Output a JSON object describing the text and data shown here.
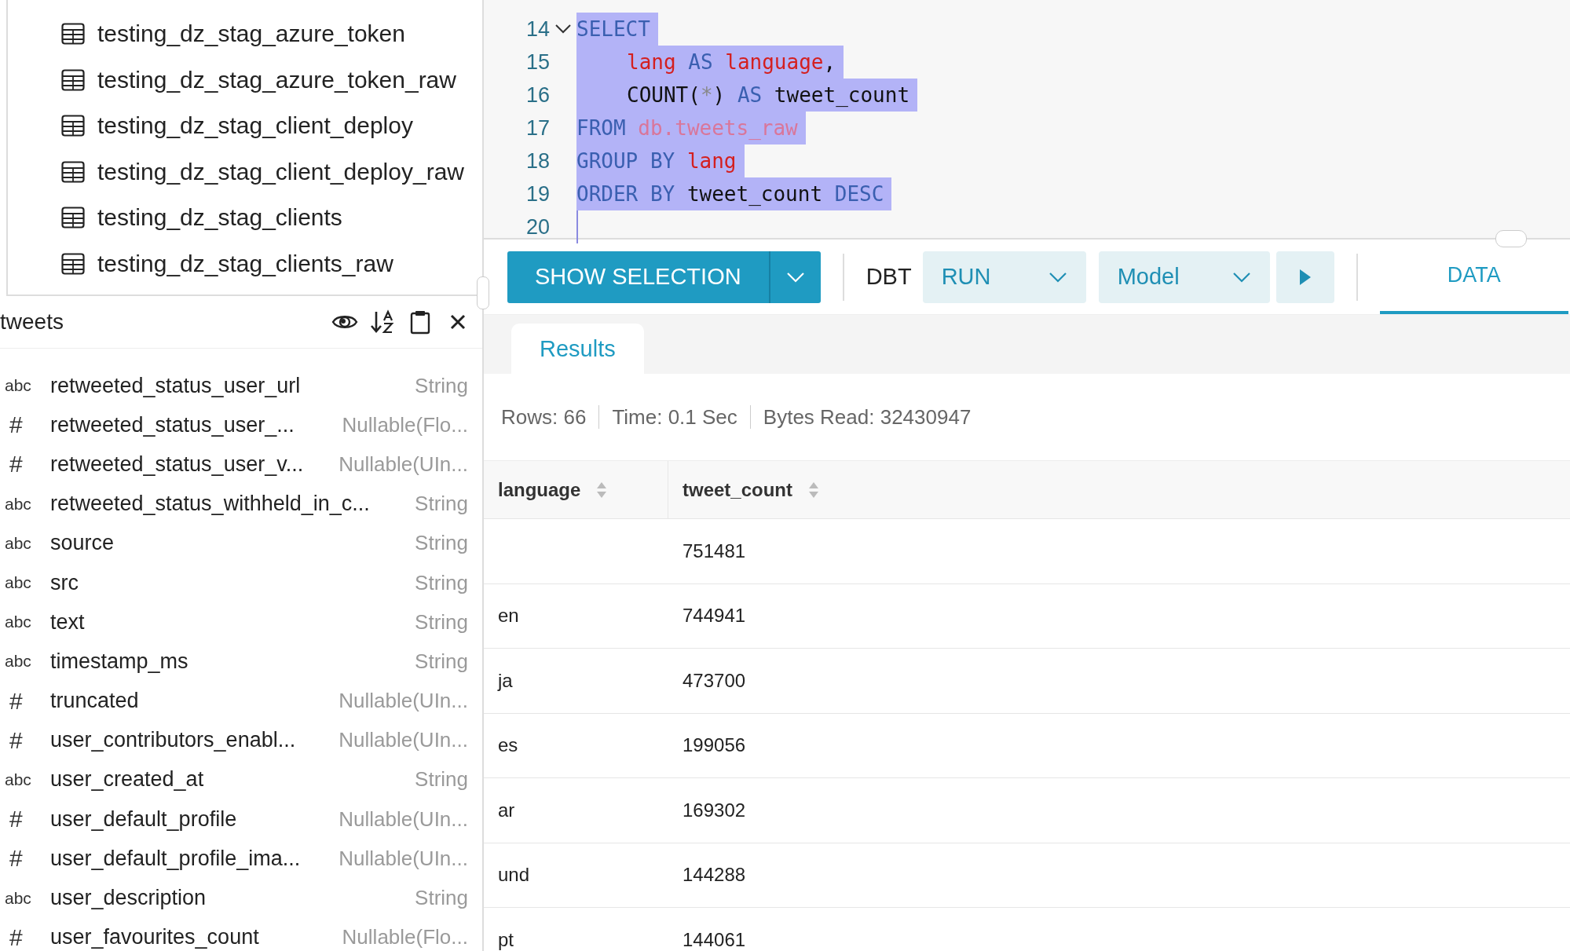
{
  "tree": {
    "items": [
      {
        "label": "testing_dz_stag_azure_token"
      },
      {
        "label": "testing_dz_stag_azure_token_raw"
      },
      {
        "label": "testing_dz_stag_client_deploy"
      },
      {
        "label": "testing_dz_stag_client_deploy_raw"
      },
      {
        "label": "testing_dz_stag_clients"
      },
      {
        "label": "testing_dz_stag_clients_raw"
      }
    ]
  },
  "schema": {
    "title": "tweets",
    "fields": [
      {
        "kind": "string",
        "type_label": "abc",
        "name": "retweeted_status_user_url",
        "type": "String"
      },
      {
        "kind": "number",
        "type_label": "#",
        "name": "retweeted_status_user_...",
        "type": "Nullable(Flo..."
      },
      {
        "kind": "number",
        "type_label": "#",
        "name": "retweeted_status_user_v...",
        "type": "Nullable(UIn..."
      },
      {
        "kind": "string",
        "type_label": "abc",
        "name": "retweeted_status_withheld_in_c...",
        "type": "String"
      },
      {
        "kind": "string",
        "type_label": "abc",
        "name": "source",
        "type": "String"
      },
      {
        "kind": "string",
        "type_label": "abc",
        "name": "src",
        "type": "String"
      },
      {
        "kind": "string",
        "type_label": "abc",
        "name": "text",
        "type": "String"
      },
      {
        "kind": "string",
        "type_label": "abc",
        "name": "timestamp_ms",
        "type": "String"
      },
      {
        "kind": "number",
        "type_label": "#",
        "name": "truncated",
        "type": "Nullable(UIn..."
      },
      {
        "kind": "number",
        "type_label": "#",
        "name": "user_contributors_enabl...",
        "type": "Nullable(UIn..."
      },
      {
        "kind": "string",
        "type_label": "abc",
        "name": "user_created_at",
        "type": "String"
      },
      {
        "kind": "number",
        "type_label": "#",
        "name": "user_default_profile",
        "type": "Nullable(UIn..."
      },
      {
        "kind": "number",
        "type_label": "#",
        "name": "user_default_profile_ima...",
        "type": "Nullable(UIn..."
      },
      {
        "kind": "string",
        "type_label": "abc",
        "name": "user_description",
        "type": "String"
      },
      {
        "kind": "number",
        "type_label": "#",
        "name": "user_favourites_count",
        "type": "Nullable(Flo..."
      }
    ]
  },
  "editor": {
    "lines": [
      {
        "number": "14",
        "foldable": true,
        "selected": true,
        "tokens": [
          {
            "kind": "keyword",
            "text": "SELECT"
          }
        ]
      },
      {
        "number": "15",
        "foldable": false,
        "selected": true,
        "indented": true,
        "tokens": [
          {
            "kind": "column",
            "text": "lang"
          },
          {
            "kind": "keyword",
            "text": " AS "
          },
          {
            "kind": "column",
            "text": "language"
          },
          {
            "kind": "plain",
            "text": ","
          }
        ]
      },
      {
        "number": "16",
        "foldable": false,
        "selected": true,
        "indented": true,
        "tokens": [
          {
            "kind": "plain",
            "text": "COUNT("
          },
          {
            "kind": "operator",
            "text": "*"
          },
          {
            "kind": "plain",
            "text": ")"
          },
          {
            "kind": "keyword",
            "text": " AS "
          },
          {
            "kind": "plain",
            "text": "tweet_count"
          }
        ]
      },
      {
        "number": "17",
        "foldable": false,
        "selected": true,
        "tokens": [
          {
            "kind": "keyword",
            "text": "FROM "
          },
          {
            "kind": "table",
            "text": "db.tweets_raw"
          }
        ]
      },
      {
        "number": "18",
        "foldable": false,
        "selected": true,
        "tokens": [
          {
            "kind": "keyword",
            "text": "GROUP BY "
          },
          {
            "kind": "column",
            "text": "lang"
          }
        ]
      },
      {
        "number": "19",
        "foldable": false,
        "selected": true,
        "tokens": [
          {
            "kind": "keyword",
            "text": "ORDER BY "
          },
          {
            "kind": "plain",
            "text": "tweet_count"
          },
          {
            "kind": "keyword",
            "text": " DESC"
          }
        ]
      },
      {
        "number": "20",
        "foldable": false
      }
    ]
  },
  "toolbar": {
    "show_selection": "SHOW SELECTION",
    "dbt_label": "DBT",
    "run_select": "RUN",
    "model_select": "Model",
    "tabs": [
      {
        "label": "DATA",
        "selected": true
      }
    ]
  },
  "results": {
    "tabs": [
      {
        "label": "Results",
        "selected": true
      }
    ],
    "stats": [
      "Rows: 66",
      "Time: 0.1 Sec",
      "Bytes Read: 32430947"
    ],
    "columns": [
      "language",
      "tweet_count"
    ],
    "rows": [
      {
        "tweet_count": "751481"
      },
      {
        "language": "en",
        "tweet_count": "744941"
      },
      {
        "language": "ja",
        "tweet_count": "473700"
      },
      {
        "language": "es",
        "tweet_count": "199056"
      },
      {
        "language": "ar",
        "tweet_count": "169302"
      },
      {
        "language": "und",
        "tweet_count": "144288"
      },
      {
        "language": "pt",
        "tweet_count": "144061"
      }
    ]
  }
}
